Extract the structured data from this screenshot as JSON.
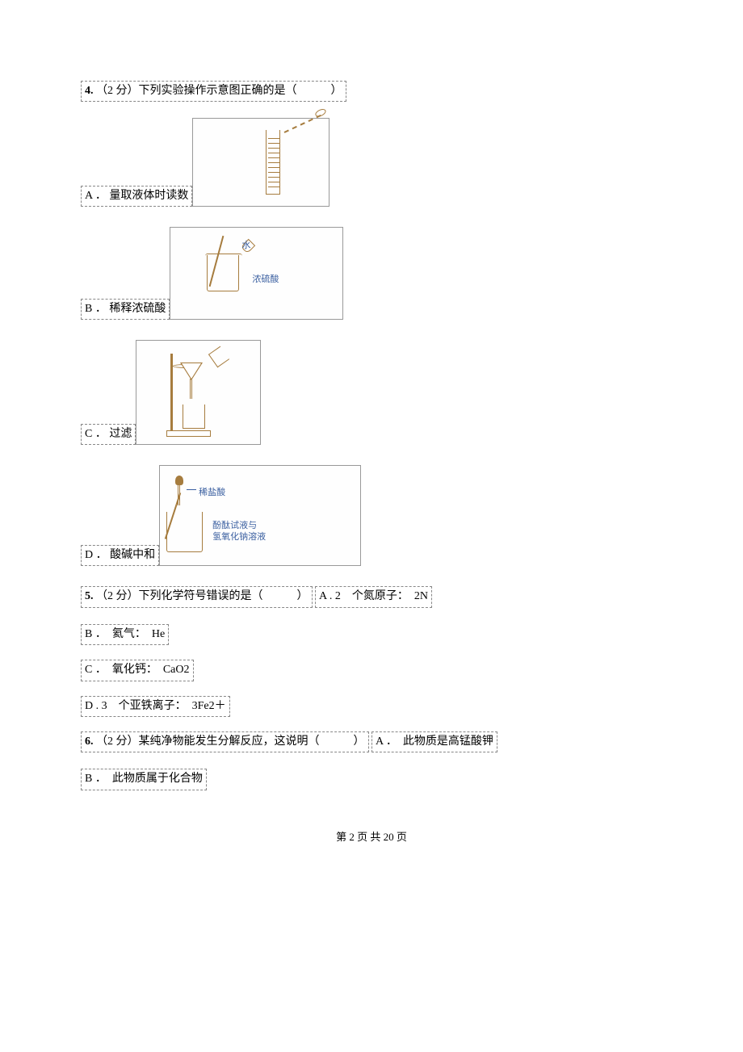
{
  "q4": {
    "number": "4.",
    "points": "（2 分）",
    "stem": "下列实验操作示意图正确的是（　　　）",
    "optA": {
      "letter": "A ．",
      "text": "量取液体时读数"
    },
    "optB": {
      "letter": "B ．",
      "text": "稀释浓硫酸",
      "img_water": "水",
      "img_acid": "浓硫酸"
    },
    "optC": {
      "letter": "C ．",
      "text": "过滤"
    },
    "optD": {
      "letter": "D ．",
      "text": "酸碱中和",
      "img_hcl": "稀盐酸",
      "img_mix1": "酚酞试液与",
      "img_mix2": "氢氧化钠溶液"
    }
  },
  "q5": {
    "number": "5.",
    "points": "（2 分）",
    "stem": "下列化学符号错误的是（　　　）",
    "optA": "A . 2　个氮原子：　2N",
    "optB": "B ．　氦气：　He",
    "optC": "C ．　氧化钙：　CaO2",
    "optD": "D . 3　个亚铁离子：　3Fe2＋"
  },
  "q6": {
    "number": "6.",
    "points": "（2 分）",
    "stem": "某纯净物能发生分解反应，这说明（　　　）",
    "optA": "A ．　此物质是高锰酸钾",
    "optB": "B ．　此物质属于化合物"
  },
  "footer": {
    "text": "第 2 页 共 20 页"
  }
}
